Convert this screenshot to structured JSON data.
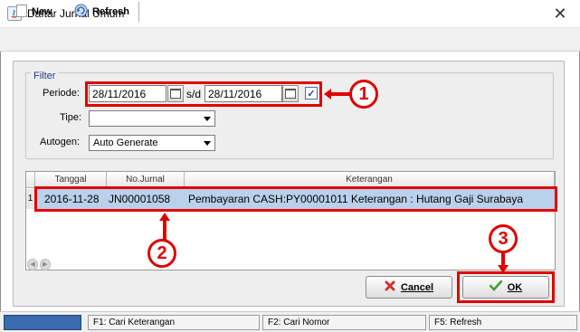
{
  "window": {
    "title": "Daftar Jurnal Umum",
    "close_glyph": "✕",
    "app_icon": "java-app-icon"
  },
  "toolbar": {
    "new_label": "New",
    "refresh_label": "Refresh"
  },
  "filter": {
    "legend": "Filter",
    "periode_label": "Periode:",
    "date_from": "28/11/2016",
    "sd_label": "s/d",
    "date_to": "28/11/2016",
    "use_period_checked": true,
    "tipe_label": "Tipe:",
    "tipe_value": "",
    "autogen_label": "Autogen:",
    "autogen_value": "Auto Generate"
  },
  "table": {
    "columns": [
      "Tanggal",
      "No.Jurnal",
      "Keterangan"
    ],
    "rows": [
      {
        "num": "1",
        "tanggal": "2016-11-28",
        "no_jurnal": "JN00001058",
        "keterangan": "Pembayaran CASH:PY00001011 Keterangan : Hutang Gaji Surabaya"
      }
    ]
  },
  "buttons": {
    "cancel_label": "Cancel",
    "ok_label": "OK"
  },
  "statusbar": {
    "items": [
      "F1: Cari Keterangan",
      "F2: Cari Nomor",
      "F5: Refresh"
    ],
    "progress_color": "#3a6ab0"
  },
  "annotations": {
    "marker1": "1",
    "marker2": "2",
    "marker3": "3",
    "color": "#e00000"
  }
}
